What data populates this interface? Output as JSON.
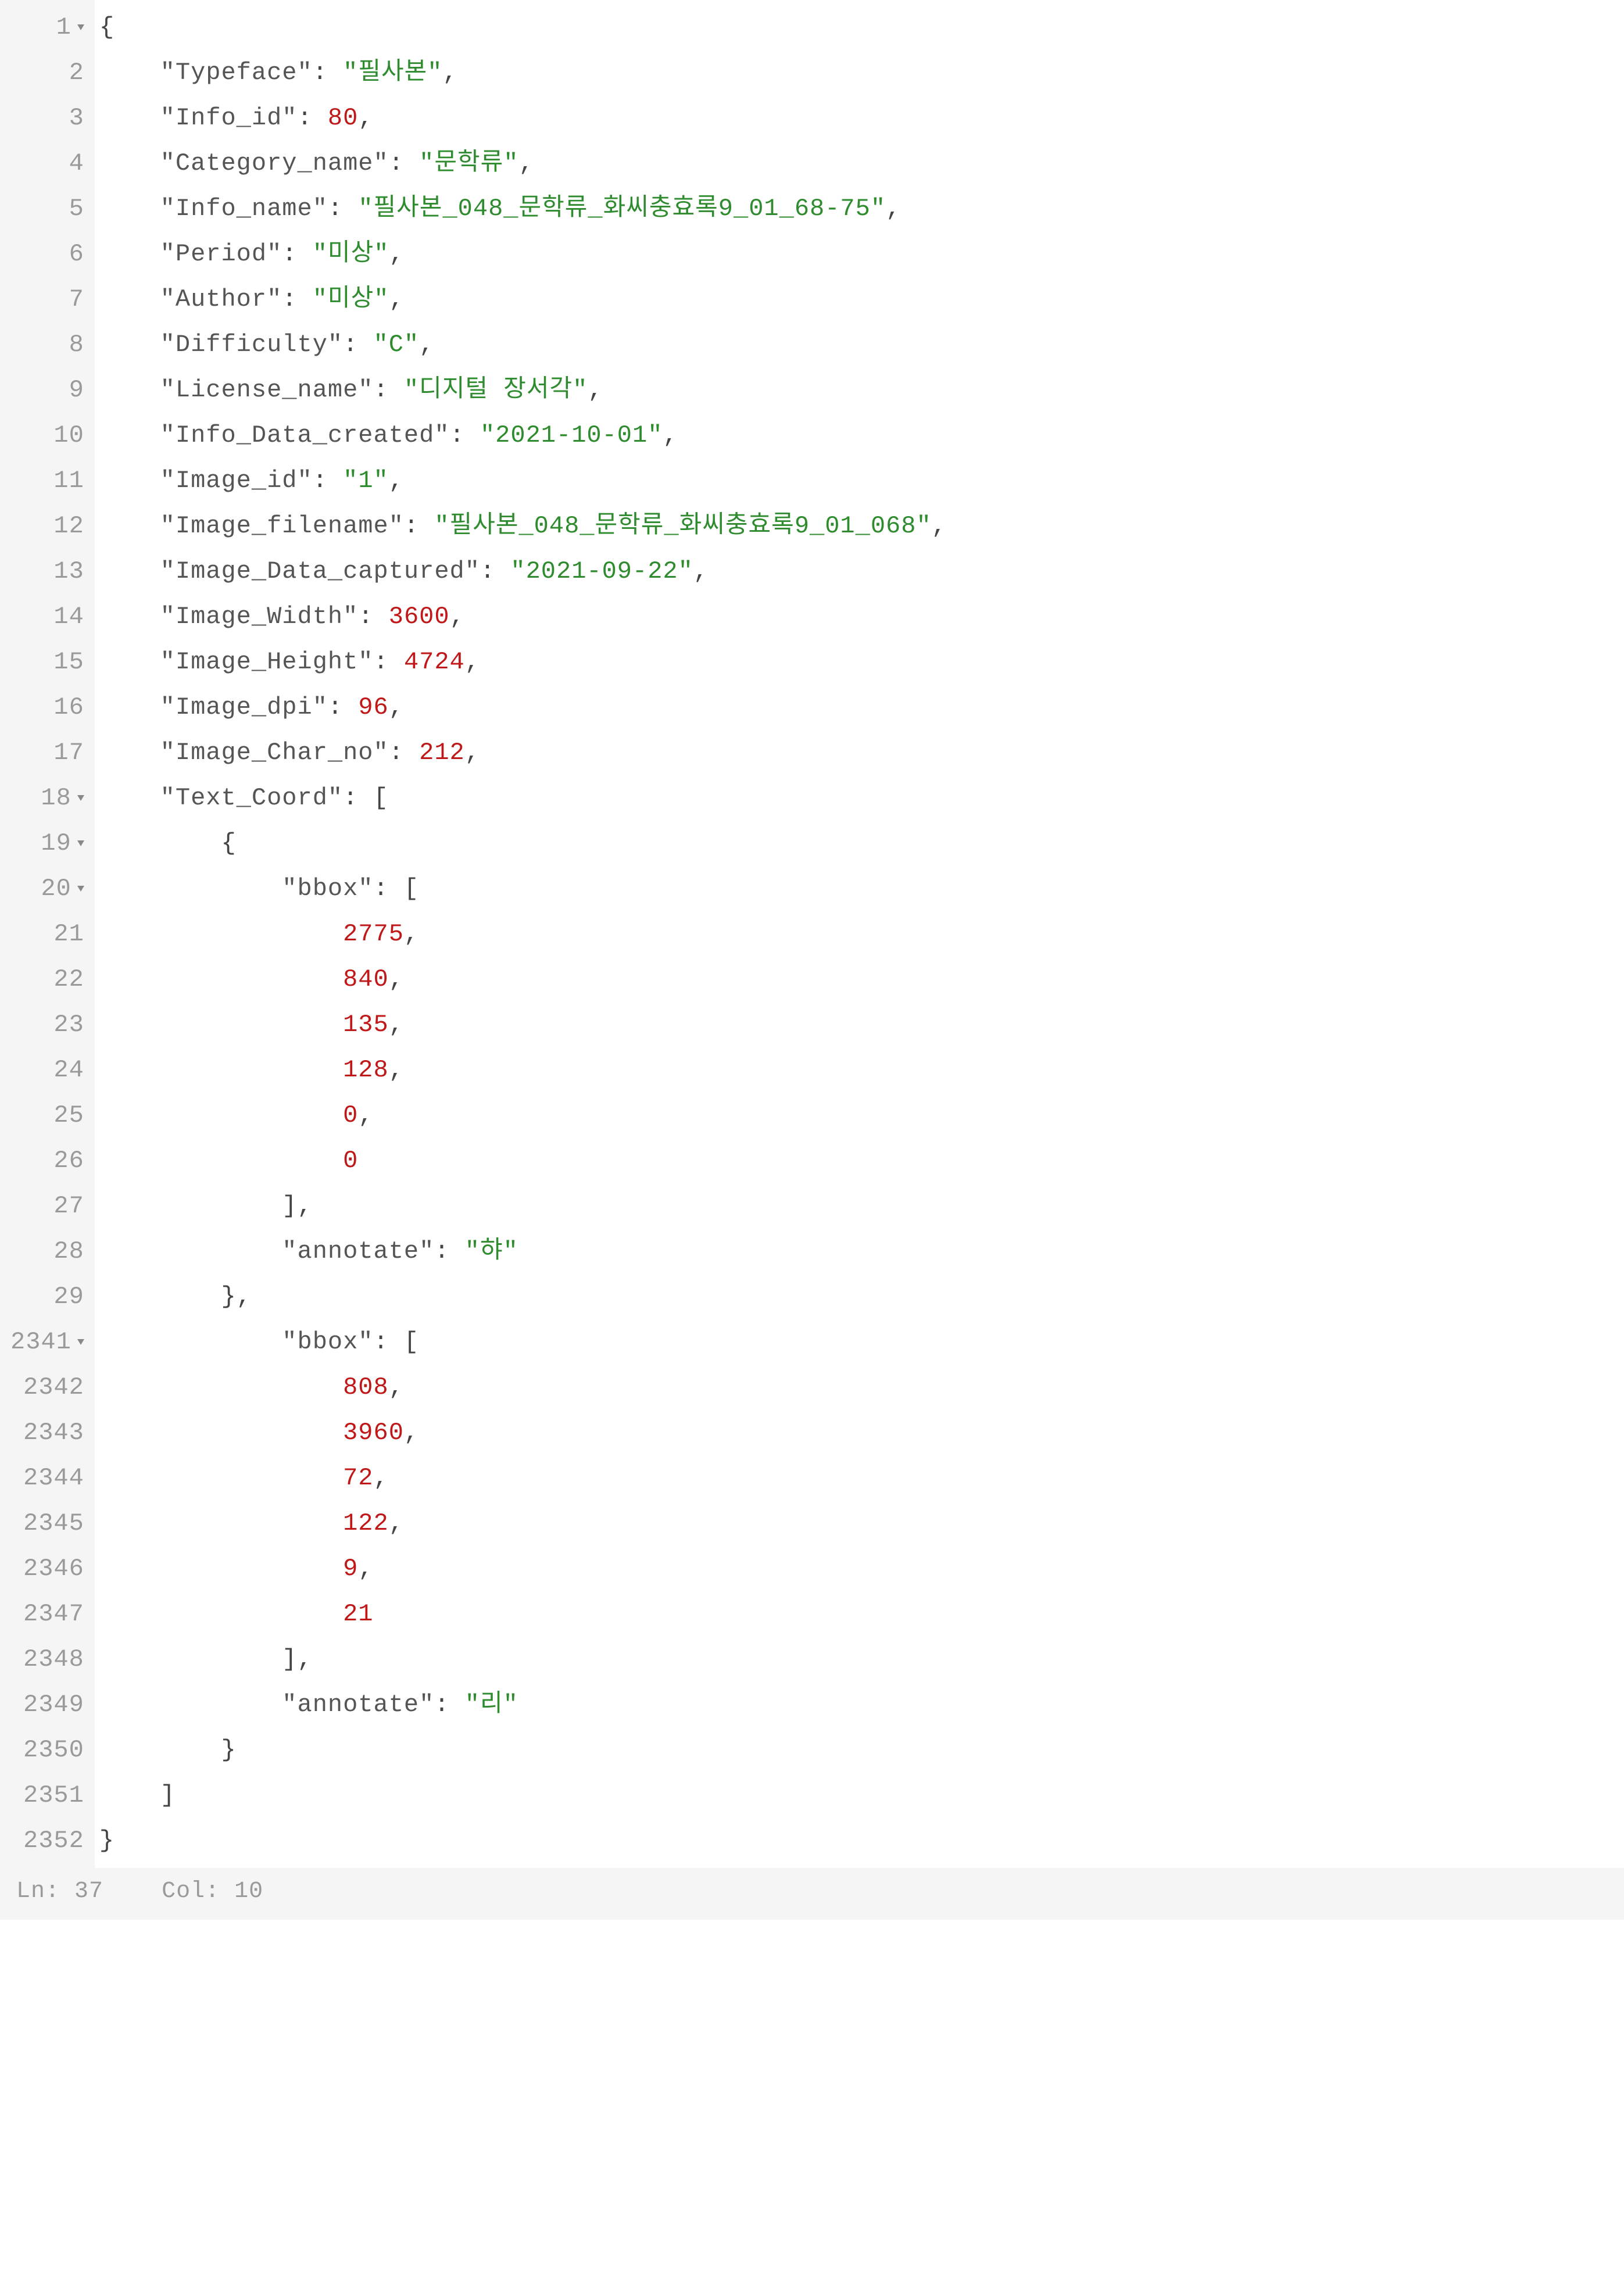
{
  "status": {
    "ln_label": "Ln:",
    "ln_value": "37",
    "col_label": "Col:",
    "col_value": "10"
  },
  "lines": [
    {
      "num": "1",
      "fold": true,
      "indent": 0,
      "tokens": [
        {
          "t": "punc",
          "v": "{"
        }
      ]
    },
    {
      "num": "2",
      "fold": false,
      "indent": 1,
      "tokens": [
        {
          "t": "key",
          "v": "\"Typeface\""
        },
        {
          "t": "punc",
          "v": ": "
        },
        {
          "t": "str",
          "v": "\"필사본\""
        },
        {
          "t": "punc",
          "v": ","
        }
      ]
    },
    {
      "num": "3",
      "fold": false,
      "indent": 1,
      "tokens": [
        {
          "t": "key",
          "v": "\"Info_id\""
        },
        {
          "t": "punc",
          "v": ": "
        },
        {
          "t": "num",
          "v": "80"
        },
        {
          "t": "punc",
          "v": ","
        }
      ]
    },
    {
      "num": "4",
      "fold": false,
      "indent": 1,
      "tokens": [
        {
          "t": "key",
          "v": "\"Category_name\""
        },
        {
          "t": "punc",
          "v": ": "
        },
        {
          "t": "str",
          "v": "\"문학류\""
        },
        {
          "t": "punc",
          "v": ","
        }
      ]
    },
    {
      "num": "5",
      "fold": false,
      "indent": 1,
      "tokens": [
        {
          "t": "key",
          "v": "\"Info_name\""
        },
        {
          "t": "punc",
          "v": ": "
        },
        {
          "t": "str",
          "v": "\"필사본_048_문학류_화씨충효록9_01_68-75\""
        },
        {
          "t": "punc",
          "v": ","
        }
      ]
    },
    {
      "num": "6",
      "fold": false,
      "indent": 1,
      "tokens": [
        {
          "t": "key",
          "v": "\"Period\""
        },
        {
          "t": "punc",
          "v": ": "
        },
        {
          "t": "str",
          "v": "\"미상\""
        },
        {
          "t": "punc",
          "v": ","
        }
      ]
    },
    {
      "num": "7",
      "fold": false,
      "indent": 1,
      "tokens": [
        {
          "t": "key",
          "v": "\"Author\""
        },
        {
          "t": "punc",
          "v": ": "
        },
        {
          "t": "str",
          "v": "\"미상\""
        },
        {
          "t": "punc",
          "v": ","
        }
      ]
    },
    {
      "num": "8",
      "fold": false,
      "indent": 1,
      "tokens": [
        {
          "t": "key",
          "v": "\"Difficulty\""
        },
        {
          "t": "punc",
          "v": ": "
        },
        {
          "t": "str",
          "v": "\"C\""
        },
        {
          "t": "punc",
          "v": ","
        }
      ]
    },
    {
      "num": "9",
      "fold": false,
      "indent": 1,
      "tokens": [
        {
          "t": "key",
          "v": "\"License_name\""
        },
        {
          "t": "punc",
          "v": ": "
        },
        {
          "t": "str",
          "v": "\"디지털 장서각\""
        },
        {
          "t": "punc",
          "v": ","
        }
      ]
    },
    {
      "num": "10",
      "fold": false,
      "indent": 1,
      "tokens": [
        {
          "t": "key",
          "v": "\"Info_Data_created\""
        },
        {
          "t": "punc",
          "v": ": "
        },
        {
          "t": "str",
          "v": "\"2021-10-01\""
        },
        {
          "t": "punc",
          "v": ","
        }
      ]
    },
    {
      "num": "11",
      "fold": false,
      "indent": 1,
      "tokens": [
        {
          "t": "key",
          "v": "\"Image_id\""
        },
        {
          "t": "punc",
          "v": ": "
        },
        {
          "t": "str",
          "v": "\"1\""
        },
        {
          "t": "punc",
          "v": ","
        }
      ]
    },
    {
      "num": "12",
      "fold": false,
      "indent": 1,
      "tokens": [
        {
          "t": "key",
          "v": "\"Image_filename\""
        },
        {
          "t": "punc",
          "v": ": "
        },
        {
          "t": "str",
          "v": "\"필사본_048_문학류_화씨충효록9_01_068\""
        },
        {
          "t": "punc",
          "v": ","
        }
      ]
    },
    {
      "num": "13",
      "fold": false,
      "indent": 1,
      "tokens": [
        {
          "t": "key",
          "v": "\"Image_Data_captured\""
        },
        {
          "t": "punc",
          "v": ": "
        },
        {
          "t": "str",
          "v": "\"2021-09-22\""
        },
        {
          "t": "punc",
          "v": ","
        }
      ]
    },
    {
      "num": "14",
      "fold": false,
      "indent": 1,
      "tokens": [
        {
          "t": "key",
          "v": "\"Image_Width\""
        },
        {
          "t": "punc",
          "v": ": "
        },
        {
          "t": "num",
          "v": "3600"
        },
        {
          "t": "punc",
          "v": ","
        }
      ]
    },
    {
      "num": "15",
      "fold": false,
      "indent": 1,
      "tokens": [
        {
          "t": "key",
          "v": "\"Image_Height\""
        },
        {
          "t": "punc",
          "v": ": "
        },
        {
          "t": "num",
          "v": "4724"
        },
        {
          "t": "punc",
          "v": ","
        }
      ]
    },
    {
      "num": "16",
      "fold": false,
      "indent": 1,
      "tokens": [
        {
          "t": "key",
          "v": "\"Image_dpi\""
        },
        {
          "t": "punc",
          "v": ": "
        },
        {
          "t": "num",
          "v": "96"
        },
        {
          "t": "punc",
          "v": ","
        }
      ]
    },
    {
      "num": "17",
      "fold": false,
      "indent": 1,
      "tokens": [
        {
          "t": "key",
          "v": "\"Image_Char_no\""
        },
        {
          "t": "punc",
          "v": ": "
        },
        {
          "t": "num",
          "v": "212"
        },
        {
          "t": "punc",
          "v": ","
        }
      ]
    },
    {
      "num": "18",
      "fold": true,
      "indent": 1,
      "tokens": [
        {
          "t": "key",
          "v": "\"Text_Coord\""
        },
        {
          "t": "punc",
          "v": ": ["
        }
      ]
    },
    {
      "num": "19",
      "fold": true,
      "indent": 2,
      "tokens": [
        {
          "t": "punc",
          "v": "{"
        }
      ]
    },
    {
      "num": "20",
      "fold": true,
      "indent": 3,
      "tokens": [
        {
          "t": "key",
          "v": "\"bbox\""
        },
        {
          "t": "punc",
          "v": ": ["
        }
      ]
    },
    {
      "num": "21",
      "fold": false,
      "indent": 4,
      "tokens": [
        {
          "t": "num",
          "v": "2775"
        },
        {
          "t": "punc",
          "v": ","
        }
      ]
    },
    {
      "num": "22",
      "fold": false,
      "indent": 4,
      "tokens": [
        {
          "t": "num",
          "v": "840"
        },
        {
          "t": "punc",
          "v": ","
        }
      ]
    },
    {
      "num": "23",
      "fold": false,
      "indent": 4,
      "tokens": [
        {
          "t": "num",
          "v": "135"
        },
        {
          "t": "punc",
          "v": ","
        }
      ]
    },
    {
      "num": "24",
      "fold": false,
      "indent": 4,
      "tokens": [
        {
          "t": "num",
          "v": "128"
        },
        {
          "t": "punc",
          "v": ","
        }
      ]
    },
    {
      "num": "25",
      "fold": false,
      "indent": 4,
      "tokens": [
        {
          "t": "num",
          "v": "0"
        },
        {
          "t": "punc",
          "v": ","
        }
      ]
    },
    {
      "num": "26",
      "fold": false,
      "indent": 4,
      "tokens": [
        {
          "t": "num",
          "v": "0"
        }
      ]
    },
    {
      "num": "27",
      "fold": false,
      "indent": 3,
      "tokens": [
        {
          "t": "punc",
          "v": "],"
        }
      ]
    },
    {
      "num": "28",
      "fold": false,
      "indent": 3,
      "tokens": [
        {
          "t": "key",
          "v": "\"annotate\""
        },
        {
          "t": "punc",
          "v": ": "
        },
        {
          "t": "str",
          "v": "\"햐\""
        }
      ]
    },
    {
      "num": "29",
      "fold": false,
      "indent": 2,
      "tokens": [
        {
          "t": "punc",
          "v": "},"
        }
      ]
    },
    {
      "num": "2341",
      "fold": true,
      "indent": 3,
      "tokens": [
        {
          "t": "key",
          "v": "\"bbox\""
        },
        {
          "t": "punc",
          "v": ": ["
        }
      ]
    },
    {
      "num": "2342",
      "fold": false,
      "indent": 4,
      "tokens": [
        {
          "t": "num",
          "v": "808"
        },
        {
          "t": "punc",
          "v": ","
        }
      ]
    },
    {
      "num": "2343",
      "fold": false,
      "indent": 4,
      "tokens": [
        {
          "t": "num",
          "v": "3960"
        },
        {
          "t": "punc",
          "v": ","
        }
      ]
    },
    {
      "num": "2344",
      "fold": false,
      "indent": 4,
      "tokens": [
        {
          "t": "num",
          "v": "72"
        },
        {
          "t": "punc",
          "v": ","
        }
      ]
    },
    {
      "num": "2345",
      "fold": false,
      "indent": 4,
      "tokens": [
        {
          "t": "num",
          "v": "122"
        },
        {
          "t": "punc",
          "v": ","
        }
      ]
    },
    {
      "num": "2346",
      "fold": false,
      "indent": 4,
      "tokens": [
        {
          "t": "num",
          "v": "9"
        },
        {
          "t": "punc",
          "v": ","
        }
      ]
    },
    {
      "num": "2347",
      "fold": false,
      "indent": 4,
      "tokens": [
        {
          "t": "num",
          "v": "21"
        }
      ]
    },
    {
      "num": "2348",
      "fold": false,
      "indent": 3,
      "tokens": [
        {
          "t": "punc",
          "v": "],"
        }
      ]
    },
    {
      "num": "2349",
      "fold": false,
      "indent": 3,
      "tokens": [
        {
          "t": "key",
          "v": "\"annotate\""
        },
        {
          "t": "punc",
          "v": ": "
        },
        {
          "t": "str",
          "v": "\"리\""
        }
      ]
    },
    {
      "num": "2350",
      "fold": false,
      "indent": 2,
      "tokens": [
        {
          "t": "punc",
          "v": "}"
        }
      ]
    },
    {
      "num": "2351",
      "fold": false,
      "indent": 1,
      "tokens": [
        {
          "t": "punc",
          "v": "]"
        }
      ]
    },
    {
      "num": "2352",
      "fold": false,
      "indent": 0,
      "tokens": [
        {
          "t": "punc",
          "v": "}"
        }
      ]
    }
  ]
}
